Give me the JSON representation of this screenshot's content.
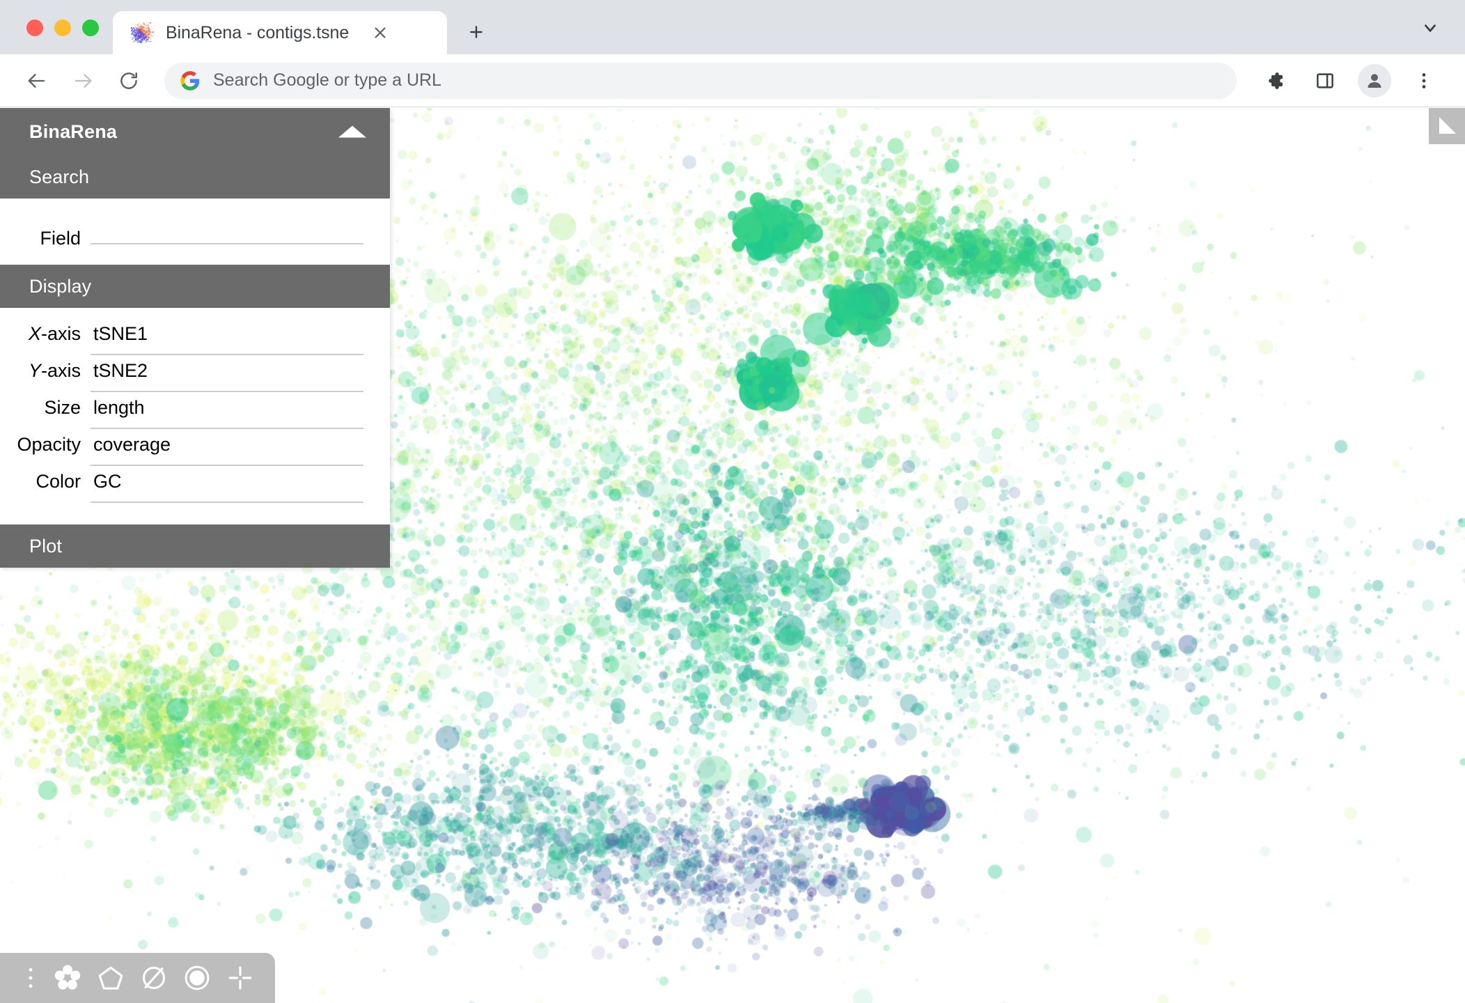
{
  "browser": {
    "tab": {
      "title": "BinaRena - contigs.tsne",
      "favicon_name": "binarena-scatter-favicon",
      "close_label": "Close tab",
      "new_tab_label": "New tab",
      "tab_search_label": "Search tabs"
    },
    "toolbar": {
      "back_label": "Back",
      "forward_label": "Forward",
      "reload_label": "Reload",
      "omnibox_placeholder": "Search Google or type a URL",
      "omnibox_value": "",
      "extensions_label": "Extensions",
      "side_panel_label": "Side panel",
      "profile_label": "Profile",
      "menu_label": "Customize and control Google Chrome"
    },
    "window_controls": {
      "close": "Close",
      "minimize": "Minimize",
      "maximize": "Maximize"
    }
  },
  "app": {
    "title": "BinaRena",
    "collapse_label": "Collapse panel",
    "sections": {
      "search": {
        "label": "Search",
        "fields": [
          {
            "label": "Field",
            "value": "",
            "placeholder": ""
          }
        ]
      },
      "display": {
        "label": "Display",
        "fields": [
          {
            "label": "X-axis",
            "label_prefix": "X",
            "label_suffix": "-axis",
            "value": "tSNE1"
          },
          {
            "label": "Y-axis",
            "label_prefix": "Y",
            "label_suffix": "-axis",
            "value": "tSNE2"
          },
          {
            "label": "Size",
            "value": "length"
          },
          {
            "label": "Opacity",
            "value": "coverage"
          },
          {
            "label": "Color",
            "value": "GC"
          }
        ]
      },
      "plot": {
        "label": "Plot"
      }
    },
    "corner_widget": {
      "name": "expand-panel-widget",
      "label": "Expand legend"
    },
    "bottom_toolbar": {
      "buttons": [
        {
          "name": "overflow-menu-icon",
          "label": "More options"
        },
        {
          "name": "flower-cluster-icon",
          "label": "Select clusters"
        },
        {
          "name": "pentagon-polygon-icon",
          "label": "Polygon selection"
        },
        {
          "name": "circle-slash-icon",
          "label": "Clear selection"
        },
        {
          "name": "mask-circle-icon",
          "label": "Mask selection"
        },
        {
          "name": "crosshair-focus-icon",
          "label": "Focus / center"
        }
      ]
    }
  },
  "colors": {
    "panel_header_gray": "#6b6b6b",
    "toolbar_gray": "#bdbdbd",
    "tab_strip_gray": "#dee1e6",
    "input_underline": "#cccccc",
    "plot_background": "#ffffff"
  },
  "chart_data": {
    "type": "scatter",
    "title": "",
    "xlabel": "tSNE1",
    "ylabel": "tSNE2",
    "size_field": "length",
    "opacity_field": "coverage",
    "color_field": "GC",
    "grid": false,
    "axes_visible": false,
    "legend_position": "none",
    "colormap": {
      "name": "viridis-reversed",
      "stops": [
        {
          "t": 0.0,
          "hex": "#e8f56a"
        },
        {
          "t": 0.18,
          "hex": "#9fe86b"
        },
        {
          "t": 0.34,
          "hex": "#4fd97f"
        },
        {
          "t": 0.5,
          "hex": "#1dc98e"
        },
        {
          "t": 0.66,
          "hex": "#35a8a0"
        },
        {
          "t": 0.8,
          "hex": "#4a85ab"
        },
        {
          "t": 0.9,
          "hex": "#3f5ba8"
        },
        {
          "t": 1.0,
          "hex": "#5b4b9c"
        }
      ]
    },
    "point_count": 10500,
    "opacity_range": [
      0.05,
      0.92
    ],
    "radius_range_px": [
      2,
      26
    ],
    "clusters": [
      {
        "name": "upper-main-diffuse",
        "cx": 0.46,
        "cy": 0.3,
        "sx": 0.155,
        "sy": 0.145,
        "n": 2100,
        "color_t": 0.17,
        "color_spread": 0.09,
        "size_mean": 3.6,
        "size_spread": 2.0,
        "alpha": 0.22
      },
      {
        "name": "upper-right-arc",
        "cx": 0.595,
        "cy": 0.135,
        "sx": 0.055,
        "sy": 0.05,
        "n": 520,
        "color_t": 0.28,
        "color_spread": 0.1,
        "size_mean": 4.2,
        "size_spread": 2.4,
        "alpha": 0.32
      },
      {
        "name": "emerald-blob-left",
        "cx": 0.527,
        "cy": 0.135,
        "sx": 0.011,
        "sy": 0.013,
        "n": 95,
        "color_t": 0.46,
        "color_spread": 0.05,
        "size_mean": 10.0,
        "size_spread": 5.0,
        "alpha": 0.7
      },
      {
        "name": "emerald-streak-right",
        "cx": 0.665,
        "cy": 0.165,
        "sx": 0.035,
        "sy": 0.018,
        "n": 430,
        "color_t": 0.42,
        "color_spread": 0.08,
        "size_mean": 5.0,
        "size_spread": 2.6,
        "alpha": 0.45
      },
      {
        "name": "emerald-blob-mid",
        "cx": 0.587,
        "cy": 0.225,
        "sx": 0.01,
        "sy": 0.012,
        "n": 80,
        "color_t": 0.46,
        "color_spread": 0.05,
        "size_mean": 10.5,
        "size_spread": 5.0,
        "alpha": 0.72
      },
      {
        "name": "emerald-blob-lower",
        "cx": 0.525,
        "cy": 0.3,
        "sx": 0.009,
        "sy": 0.011,
        "n": 70,
        "color_t": 0.48,
        "color_spread": 0.05,
        "size_mean": 10.0,
        "size_spread": 5.0,
        "alpha": 0.74
      },
      {
        "name": "center-body",
        "cx": 0.4,
        "cy": 0.5,
        "sx": 0.15,
        "sy": 0.16,
        "n": 2300,
        "color_t": 0.4,
        "color_spread": 0.12,
        "size_mean": 3.8,
        "size_spread": 2.2,
        "alpha": 0.22
      },
      {
        "name": "teal-diagonal-band",
        "cx": 0.5,
        "cy": 0.565,
        "sx": 0.045,
        "sy": 0.085,
        "n": 620,
        "color_t": 0.56,
        "color_spread": 0.09,
        "size_mean": 4.6,
        "size_spread": 2.8,
        "alpha": 0.35
      },
      {
        "name": "right-wing-teal",
        "cx": 0.745,
        "cy": 0.565,
        "sx": 0.115,
        "sy": 0.075,
        "n": 1250,
        "color_t": 0.62,
        "color_spread": 0.09,
        "size_mean": 3.6,
        "size_spread": 2.2,
        "alpha": 0.25
      },
      {
        "name": "left-yellow-green",
        "cx": 0.105,
        "cy": 0.665,
        "sx": 0.065,
        "sy": 0.05,
        "n": 950,
        "color_t": 0.06,
        "color_spread": 0.07,
        "size_mean": 3.8,
        "size_spread": 2.4,
        "alpha": 0.28
      },
      {
        "name": "left-green-mass",
        "cx": 0.135,
        "cy": 0.705,
        "sx": 0.045,
        "sy": 0.038,
        "n": 760,
        "color_t": 0.26,
        "color_spread": 0.09,
        "size_mean": 4.4,
        "size_spread": 2.6,
        "alpha": 0.32
      },
      {
        "name": "lower-center-teal",
        "cx": 0.345,
        "cy": 0.81,
        "sx": 0.065,
        "sy": 0.042,
        "n": 900,
        "color_t": 0.66,
        "color_spread": 0.08,
        "size_mean": 4.0,
        "size_spread": 2.4,
        "alpha": 0.3
      },
      {
        "name": "lower-purple-cloud",
        "cx": 0.505,
        "cy": 0.845,
        "sx": 0.052,
        "sy": 0.04,
        "n": 780,
        "color_t": 0.86,
        "color_spread": 0.1,
        "size_mean": 3.6,
        "size_spread": 2.2,
        "alpha": 0.26
      },
      {
        "name": "navy-blob-right",
        "cx": 0.615,
        "cy": 0.785,
        "sx": 0.012,
        "sy": 0.012,
        "n": 120,
        "color_t": 0.95,
        "color_spread": 0.06,
        "size_mean": 9.0,
        "size_spread": 4.5,
        "alpha": 0.6
      },
      {
        "name": "navy-trail",
        "cx": 0.572,
        "cy": 0.788,
        "sx": 0.018,
        "sy": 0.006,
        "n": 110,
        "color_t": 0.8,
        "color_spread": 0.1,
        "size_mean": 4.0,
        "size_spread": 2.2,
        "alpha": 0.4
      },
      {
        "name": "sparse-halo",
        "cx": 0.46,
        "cy": 0.5,
        "sx": 0.27,
        "sy": 0.27,
        "n": 1415,
        "color_t": 0.42,
        "color_spread": 0.26,
        "size_mean": 3.2,
        "size_spread": 2.0,
        "alpha": 0.14
      }
    ]
  }
}
